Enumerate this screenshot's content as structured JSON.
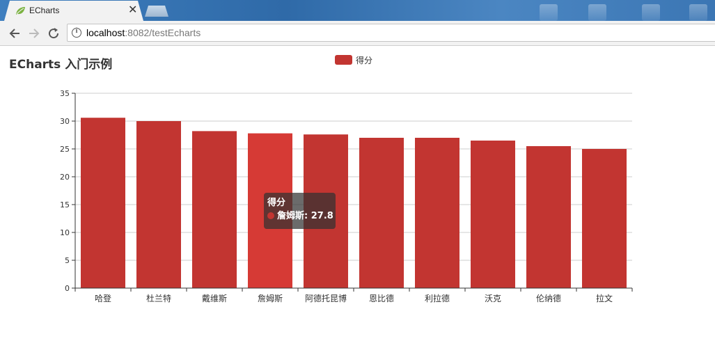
{
  "browser": {
    "tab_title": "ECharts",
    "url_host": "localhost",
    "url_rest": ":8082/testEcharts"
  },
  "page": {
    "title": "ECharts 入门示例"
  },
  "colors": {
    "bar": "#c23531",
    "bar_highlight": "#d63a35"
  },
  "tooltip": {
    "series": "得分",
    "label": "詹姆斯: 27.8"
  },
  "chart_data": {
    "type": "bar",
    "title": "ECharts 入门示例",
    "legend": [
      "得分"
    ],
    "legend_position": "top-center",
    "categories": [
      "哈登",
      "杜兰特",
      "戴维斯",
      "詹姆斯",
      "阿德托昆博",
      "恩比德",
      "利拉德",
      "沃克",
      "伦纳德",
      "拉文"
    ],
    "series": [
      {
        "name": "得分",
        "values": [
          30.6,
          30.0,
          28.2,
          27.8,
          27.6,
          27.0,
          27.0,
          26.5,
          25.5,
          25.0
        ]
      }
    ],
    "ylim": [
      0,
      35
    ],
    "yticks": [
      "0",
      "5",
      "10",
      "15",
      "20",
      "25",
      "30",
      "35"
    ],
    "grid": true,
    "highlighted_category": "詹姆斯"
  }
}
